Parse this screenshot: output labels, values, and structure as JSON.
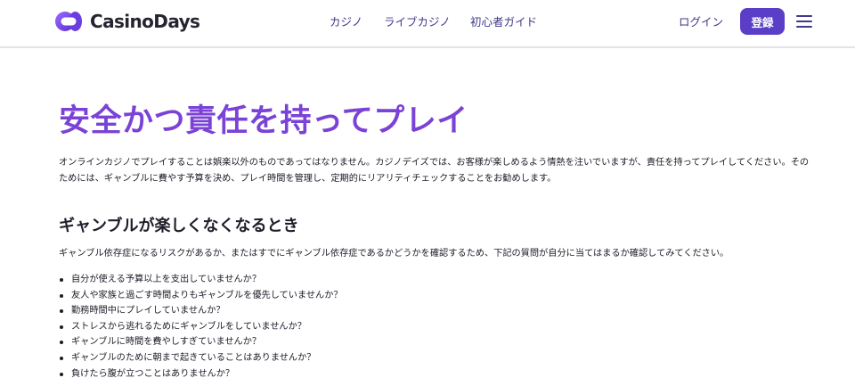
{
  "header": {
    "logo_text": "CasinoDays",
    "nav": [
      "カジノ",
      "ライブカジノ",
      "初心者ガイド"
    ],
    "login_label": "ログイン",
    "register_label": "登録",
    "menu_icon": "hamburger-menu-icon"
  },
  "main": {
    "title": "安全かつ責任を持ってプレイ",
    "intro": "オンラインカジノでプレイすることは娯楽以外のものであってはなりません。カジノデイズでは、お客様が楽しめるよう情熱を注いでいますが、責任を持ってプレイしてください。そのためには、ギャンブルに費やす予算を決め、プレイ時間を管理し、定期的にリアリティチェックすることをお勧めします。",
    "section_heading": "ギャンブルが楽しくなくなるとき",
    "section_intro": "ギャンブル依存症になるリスクがあるか、またはすでにギャンブル依存症であるかどうかを確認するため、下記の質問が自分に当てはまるか確認してみてください。",
    "questions": [
      "自分が使える予算以上を支出していませんか？",
      "友人や家族と過ごす時間よりもギャンブルを優先していませんか？",
      "勤務時間中にプレイしていませんか？",
      "ストレスから逃れるためにギャンブルをしていませんか？",
      "ギャンブルに時間を費やしすぎていませんか？",
      "ギャンブルのために朝まで起きていることはありませんか？",
      "負けたら腹が立つことはありませんか？"
    ]
  },
  "colors": {
    "accent_purple": "#5a3ec8",
    "title_purple": "#7a42d6",
    "nav_text": "#3f3a8a"
  }
}
